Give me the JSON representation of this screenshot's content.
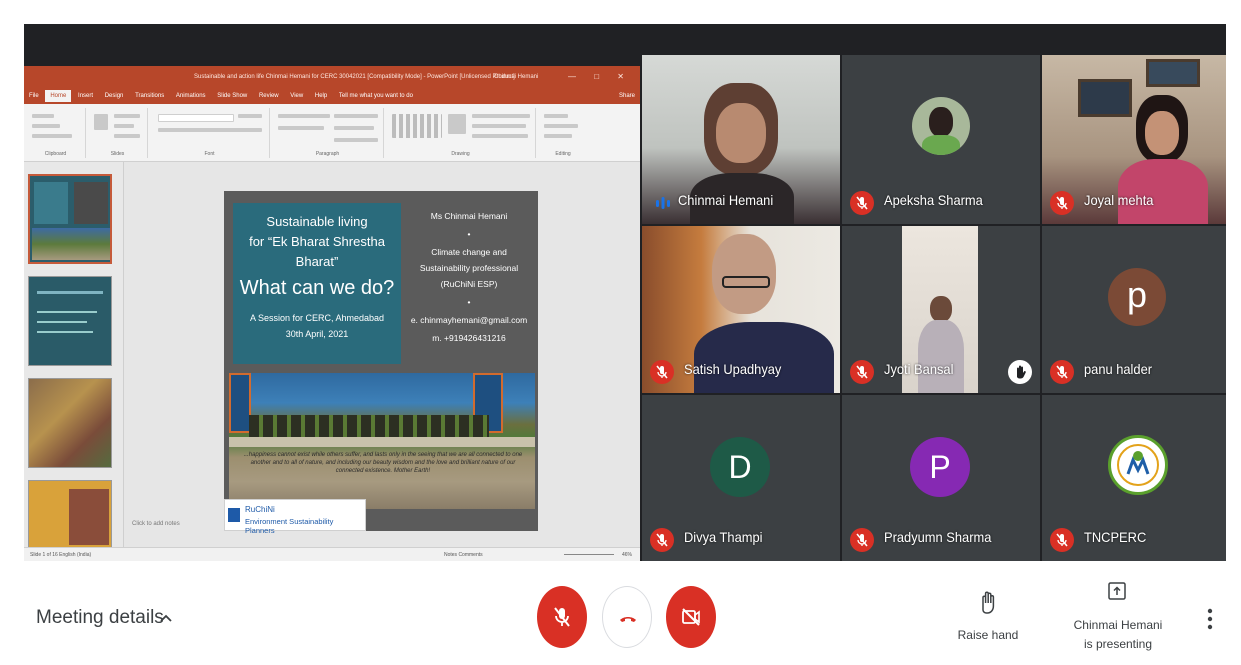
{
  "presentation": {
    "title_bar": "Sustainable and action life Chinmai Hemani for CERC 30042021 [Compatibility Mode] - PowerPoint [Unlicensed Product]",
    "account": "Chinmai Hemani",
    "tabs": [
      "File",
      "Home",
      "Insert",
      "Design",
      "Transitions",
      "Animations",
      "Slide Show",
      "Review",
      "View",
      "Help",
      "Tell me what you want to do"
    ],
    "active_tab": "Home",
    "share_label": "Share",
    "ribbon_groups": [
      "Clipboard",
      "Slides",
      "Font",
      "Paragraph",
      "Drawing",
      "Editing"
    ],
    "slide": {
      "left_lines": [
        "Sustainable living",
        "for “Ek Bharat Shrestha",
        "Bharat”",
        "What can we do?",
        "A Session for CERC, Ahmedabad",
        "30th April, 2021"
      ],
      "right_lines": [
        "Ms Chinmai Hemani",
        "•",
        "Climate change and",
        "Sustainability professional",
        "(RuChiNi ESP)",
        "•",
        "e. chinmayhemani@gmail.com",
        "m. +919426431216"
      ],
      "quote": "...happiness cannot exist while others suffer, and lasts only in the seeing that we are all connected to one another and to all of nature, and including our beauty wisdom and the love and brilliant nature of our connected existence. Mother Earth!",
      "logo_name": "RuChiNi",
      "logo_tagline": "Environment Sustainability Planners"
    },
    "notes_placeholder": "Click to add notes",
    "status_left": "Slide 1 of 16    English (India)",
    "status_right": "Notes   Comments",
    "zoom": "46%"
  },
  "participants": [
    {
      "name": "Chinmai Hemani",
      "muted": false,
      "speaking": true
    },
    {
      "name": "Apeksha Sharma",
      "muted": true
    },
    {
      "name": "Joyal mehta",
      "muted": true
    },
    {
      "name": "Satish Upadhyay",
      "muted": true
    },
    {
      "name": "Jyoti Bansal",
      "muted": true,
      "hand_raised": true
    },
    {
      "name": "panu halder",
      "muted": true,
      "initial": "p",
      "avatar_color": "#7b4a36"
    },
    {
      "name": "Divya Thampi",
      "muted": true,
      "initial": "D",
      "avatar_color": "#1e5a47"
    },
    {
      "name": "Pradyumn Sharma",
      "muted": true,
      "initial": "P",
      "avatar_color": "#8629b3"
    },
    {
      "name": "TNCPERC",
      "muted": true
    }
  ],
  "bottom_bar": {
    "meeting_details": "Meeting details",
    "raise_hand": "Raise hand",
    "presenting_line1": "Chinmai Hemani",
    "presenting_line2": "is presenting"
  },
  "colors": {
    "meet_red": "#d93025",
    "stage_bg": "#202124",
    "tile_bg": "#3c4043",
    "ppt_brand": "#b7472a"
  }
}
